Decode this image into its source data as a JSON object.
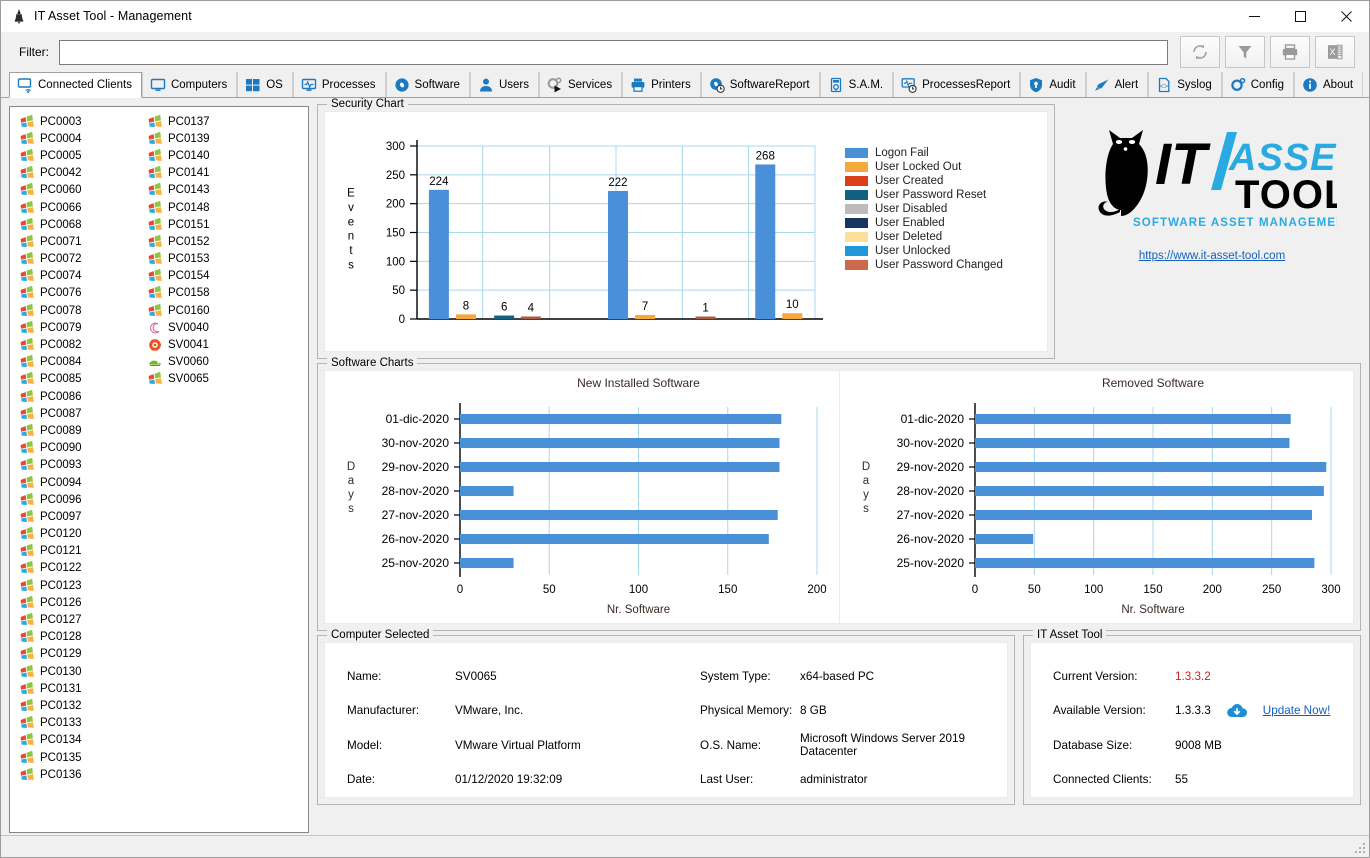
{
  "window": {
    "title": "IT Asset Tool - Management",
    "icon": "app-icon",
    "minimize_label": "–",
    "maximize_label": "□",
    "close_label": "✕"
  },
  "filter": {
    "label": "Filter:",
    "value": "",
    "placeholder": ""
  },
  "toolbar": {
    "buttons": [
      {
        "name": "refresh-button",
        "icon": "refresh-icon",
        "title": "Refresh"
      },
      {
        "name": "filter-button",
        "icon": "funnel-icon",
        "title": "Filter"
      },
      {
        "name": "print-button",
        "icon": "printer-icon",
        "title": "Print"
      },
      {
        "name": "excel-export-button",
        "icon": "excel-icon",
        "title": "Export to Excel"
      }
    ]
  },
  "tabs": [
    {
      "label": "Connected Clients",
      "icon": "monitor-wifi-icon",
      "active": true
    },
    {
      "label": "Computers",
      "icon": "monitor-icon",
      "active": false
    },
    {
      "label": "OS",
      "icon": "windows-icon",
      "active": false
    },
    {
      "label": "Processes",
      "icon": "monitor-pulse-icon",
      "active": false
    },
    {
      "label": "Software",
      "icon": "disc-icon",
      "active": false
    },
    {
      "label": "Users",
      "icon": "user-icon",
      "active": false
    },
    {
      "label": "Services",
      "icon": "gears-play-icon",
      "active": false
    },
    {
      "label": "Printers",
      "icon": "printer-icon",
      "active": false
    },
    {
      "label": "SoftwareReport",
      "icon": "disc-clock-icon",
      "active": false
    },
    {
      "label": "S.A.M.",
      "icon": "sam-icon",
      "active": false
    },
    {
      "label": "ProcessesReport",
      "icon": "monitor-clock-icon",
      "active": false
    },
    {
      "label": "Audit",
      "icon": "shield-icon",
      "active": false
    },
    {
      "label": "Alert",
      "icon": "megaphone-icon",
      "active": false
    },
    {
      "label": "Syslog",
      "icon": "code-file-icon",
      "active": false
    },
    {
      "label": "Config",
      "icon": "gear-icon",
      "active": false
    },
    {
      "label": "About",
      "icon": "info-icon",
      "active": false
    }
  ],
  "client_list": {
    "column1": [
      {
        "label": "PC0003",
        "icon": "windows-logo-icon"
      },
      {
        "label": "PC0004",
        "icon": "windows-logo-icon"
      },
      {
        "label": "PC0005",
        "icon": "windows-logo-icon"
      },
      {
        "label": "PC0042",
        "icon": "windows-logo-icon"
      },
      {
        "label": "PC0060",
        "icon": "windows-logo-icon"
      },
      {
        "label": "PC0066",
        "icon": "windows-logo-icon"
      },
      {
        "label": "PC0068",
        "icon": "windows-logo-icon"
      },
      {
        "label": "PC0071",
        "icon": "windows-logo-icon"
      },
      {
        "label": "PC0072",
        "icon": "windows-logo-icon"
      },
      {
        "label": "PC0074",
        "icon": "windows-logo-icon"
      },
      {
        "label": "PC0076",
        "icon": "windows-logo-icon"
      },
      {
        "label": "PC0078",
        "icon": "windows-logo-icon"
      },
      {
        "label": "PC0079",
        "icon": "windows-logo-icon"
      },
      {
        "label": "PC0082",
        "icon": "windows-logo-icon"
      },
      {
        "label": "PC0084",
        "icon": "windows-logo-icon"
      },
      {
        "label": "PC0085",
        "icon": "windows-logo-icon"
      },
      {
        "label": "PC0086",
        "icon": "windows-logo-icon"
      },
      {
        "label": "PC0087",
        "icon": "windows-logo-icon"
      },
      {
        "label": "PC0089",
        "icon": "windows-logo-icon"
      },
      {
        "label": "PC0090",
        "icon": "windows-logo-icon"
      },
      {
        "label": "PC0093",
        "icon": "windows-logo-icon"
      },
      {
        "label": "PC0094",
        "icon": "windows-logo-icon"
      },
      {
        "label": "PC0096",
        "icon": "windows-logo-icon"
      },
      {
        "label": "PC0097",
        "icon": "windows-logo-icon"
      },
      {
        "label": "PC0120",
        "icon": "windows-logo-icon"
      },
      {
        "label": "PC0121",
        "icon": "windows-logo-icon"
      },
      {
        "label": "PC0122",
        "icon": "windows-logo-icon"
      },
      {
        "label": "PC0123",
        "icon": "windows-logo-icon"
      },
      {
        "label": "PC0126",
        "icon": "windows-logo-icon"
      },
      {
        "label": "PC0127",
        "icon": "windows-logo-icon"
      },
      {
        "label": "PC0128",
        "icon": "windows-logo-icon"
      },
      {
        "label": "PC0129",
        "icon": "windows-logo-icon"
      },
      {
        "label": "PC0130",
        "icon": "windows-logo-icon"
      },
      {
        "label": "PC0131",
        "icon": "windows-logo-icon"
      },
      {
        "label": "PC0132",
        "icon": "windows-logo-icon"
      },
      {
        "label": "PC0133",
        "icon": "windows-logo-icon"
      },
      {
        "label": "PC0134",
        "icon": "windows-logo-icon"
      },
      {
        "label": "PC0135",
        "icon": "windows-logo-icon"
      },
      {
        "label": "PC0136",
        "icon": "windows-logo-icon"
      }
    ],
    "column2": [
      {
        "label": "PC0137",
        "icon": "windows-logo-icon"
      },
      {
        "label": "PC0139",
        "icon": "windows-logo-icon"
      },
      {
        "label": "PC0140",
        "icon": "windows-logo-icon"
      },
      {
        "label": "PC0141",
        "icon": "windows-logo-icon"
      },
      {
        "label": "PC0143",
        "icon": "windows-logo-icon"
      },
      {
        "label": "PC0148",
        "icon": "windows-logo-icon"
      },
      {
        "label": "PC0151",
        "icon": "windows-logo-icon"
      },
      {
        "label": "PC0152",
        "icon": "windows-logo-icon"
      },
      {
        "label": "PC0153",
        "icon": "windows-logo-icon"
      },
      {
        "label": "PC0154",
        "icon": "windows-logo-icon"
      },
      {
        "label": "PC0158",
        "icon": "windows-logo-icon"
      },
      {
        "label": "PC0160",
        "icon": "windows-logo-icon"
      },
      {
        "label": "SV0040",
        "icon": "debian-icon"
      },
      {
        "label": "SV0041",
        "icon": "ubuntu-icon"
      },
      {
        "label": "SV0060",
        "icon": "suse-icon"
      },
      {
        "label": "SV0065",
        "icon": "windows-logo-icon"
      }
    ]
  },
  "security_panel": {
    "title": "Security Chart"
  },
  "software_panel": {
    "title": "Software Charts"
  },
  "logo": {
    "text_it": "IT",
    "text_asset": "ASSET",
    "text_tool": "TOOL",
    "tagline": "SOFTWARE ASSET MANAGEMENT",
    "url": "https://www.it-asset-tool.com",
    "color_accent": "#29ABE2",
    "color_dark": "#000000"
  },
  "computer_selected": {
    "title": "Computer Selected",
    "fields": [
      {
        "key": "Name:",
        "value": "SV0065"
      },
      {
        "key": "System Type:",
        "value": "x64-based PC"
      },
      {
        "key": "Manufacturer:",
        "value": "VMware, Inc."
      },
      {
        "key": "Physical Memory:",
        "value": "8 GB"
      },
      {
        "key": "Model:",
        "value": "VMware Virtual Platform"
      },
      {
        "key": "O.S. Name:",
        "value": "Microsoft Windows Server 2019 Datacenter"
      },
      {
        "key": "Date:",
        "value": "01/12/2020 19:32:09"
      },
      {
        "key": "Last User:",
        "value": "administrator"
      }
    ]
  },
  "it_asset_tool": {
    "title": "IT Asset Tool",
    "current_version_label": "Current Version:",
    "current_version": "1.3.3.2",
    "current_version_color": "#cc2222",
    "available_version_label": "Available Version:",
    "available_version": "1.3.3.3",
    "update_link": "Update Now!",
    "update_icon": "cloud-download-icon",
    "database_size_label": "Database Size:",
    "database_size": "9008 MB",
    "connected_clients_label": "Connected Clients:",
    "connected_clients": "55"
  },
  "chart_data": [
    {
      "type": "bar",
      "name": "security-chart",
      "title": "",
      "xlabel": "",
      "ylabel": "Events",
      "ylim": [
        0,
        300
      ],
      "yticks": [
        0,
        50,
        100,
        150,
        200,
        250,
        300
      ],
      "grid": true,
      "legend_position": "right",
      "legend": [
        {
          "label": "Logon Fail",
          "color": "#4a90d9"
        },
        {
          "label": "User Locked Out",
          "color": "#f5a83c"
        },
        {
          "label": "User Created",
          "color": "#d9401a"
        },
        {
          "label": "User Password Reset",
          "color": "#126080"
        },
        {
          "label": "User Disabled",
          "color": "#bcbcbc"
        },
        {
          "label": "User Enabled",
          "color": "#17365d"
        },
        {
          "label": "User Deleted",
          "color": "#fbdf9a"
        },
        {
          "label": "User Unlocked",
          "color": "#2196d9"
        },
        {
          "label": "User Password Changed",
          "color": "#cc6a4e"
        }
      ],
      "bars": [
        {
          "series": "Logon Fail",
          "value": 224,
          "color": "#4a90d9",
          "x": 0.055
        },
        {
          "series": "User Locked Out",
          "value": 8,
          "color": "#f5a83c",
          "x": 0.123
        },
        {
          "series": "User Password Reset",
          "value": 6,
          "color": "#126080",
          "x": 0.219
        },
        {
          "series": "User Password Changed",
          "value": 4,
          "color": "#a45c45",
          "x": 0.286
        },
        {
          "series": "Logon Fail",
          "value": 222,
          "color": "#4a90d9",
          "x": 0.505
        },
        {
          "series": "User Locked Out",
          "value": 7,
          "color": "#f5a83c",
          "x": 0.573
        },
        {
          "series": "User Password Changed",
          "value": 1,
          "color": "#a45c45",
          "x": 0.725
        },
        {
          "series": "Logon Fail",
          "value": 268,
          "color": "#4a90d9",
          "x": 0.875
        },
        {
          "series": "User Locked Out",
          "value": 10,
          "color": "#f5a83c",
          "x": 0.943
        }
      ]
    },
    {
      "type": "bar",
      "orientation": "horizontal",
      "name": "new-installed-software-chart",
      "title": "New Installed Software",
      "xlabel": "Nr. Software",
      "ylabel": "Days",
      "xlim": [
        0,
        200
      ],
      "xticks": [
        0,
        50,
        100,
        150,
        200
      ],
      "grid": true,
      "bar_color": "#4a90d9",
      "categories": [
        "01-dic-2020",
        "30-nov-2020",
        "29-nov-2020",
        "28-nov-2020",
        "27-nov-2020",
        "26-nov-2020",
        "25-nov-2020"
      ],
      "values": [
        180,
        179,
        179,
        30,
        178,
        173,
        30
      ]
    },
    {
      "type": "bar",
      "orientation": "horizontal",
      "name": "removed-software-chart",
      "title": "Removed Software",
      "xlabel": "Nr. Software",
      "ylabel": "Days",
      "xlim": [
        0,
        300
      ],
      "xticks": [
        0,
        50,
        100,
        150,
        200,
        250,
        300
      ],
      "grid": true,
      "bar_color": "#4a90d9",
      "categories": [
        "01-dic-2020",
        "30-nov-2020",
        "29-nov-2020",
        "28-nov-2020",
        "27-nov-2020",
        "26-nov-2020",
        "25-nov-2020"
      ],
      "values": [
        266,
        265,
        296,
        294,
        284,
        49,
        286
      ]
    }
  ]
}
